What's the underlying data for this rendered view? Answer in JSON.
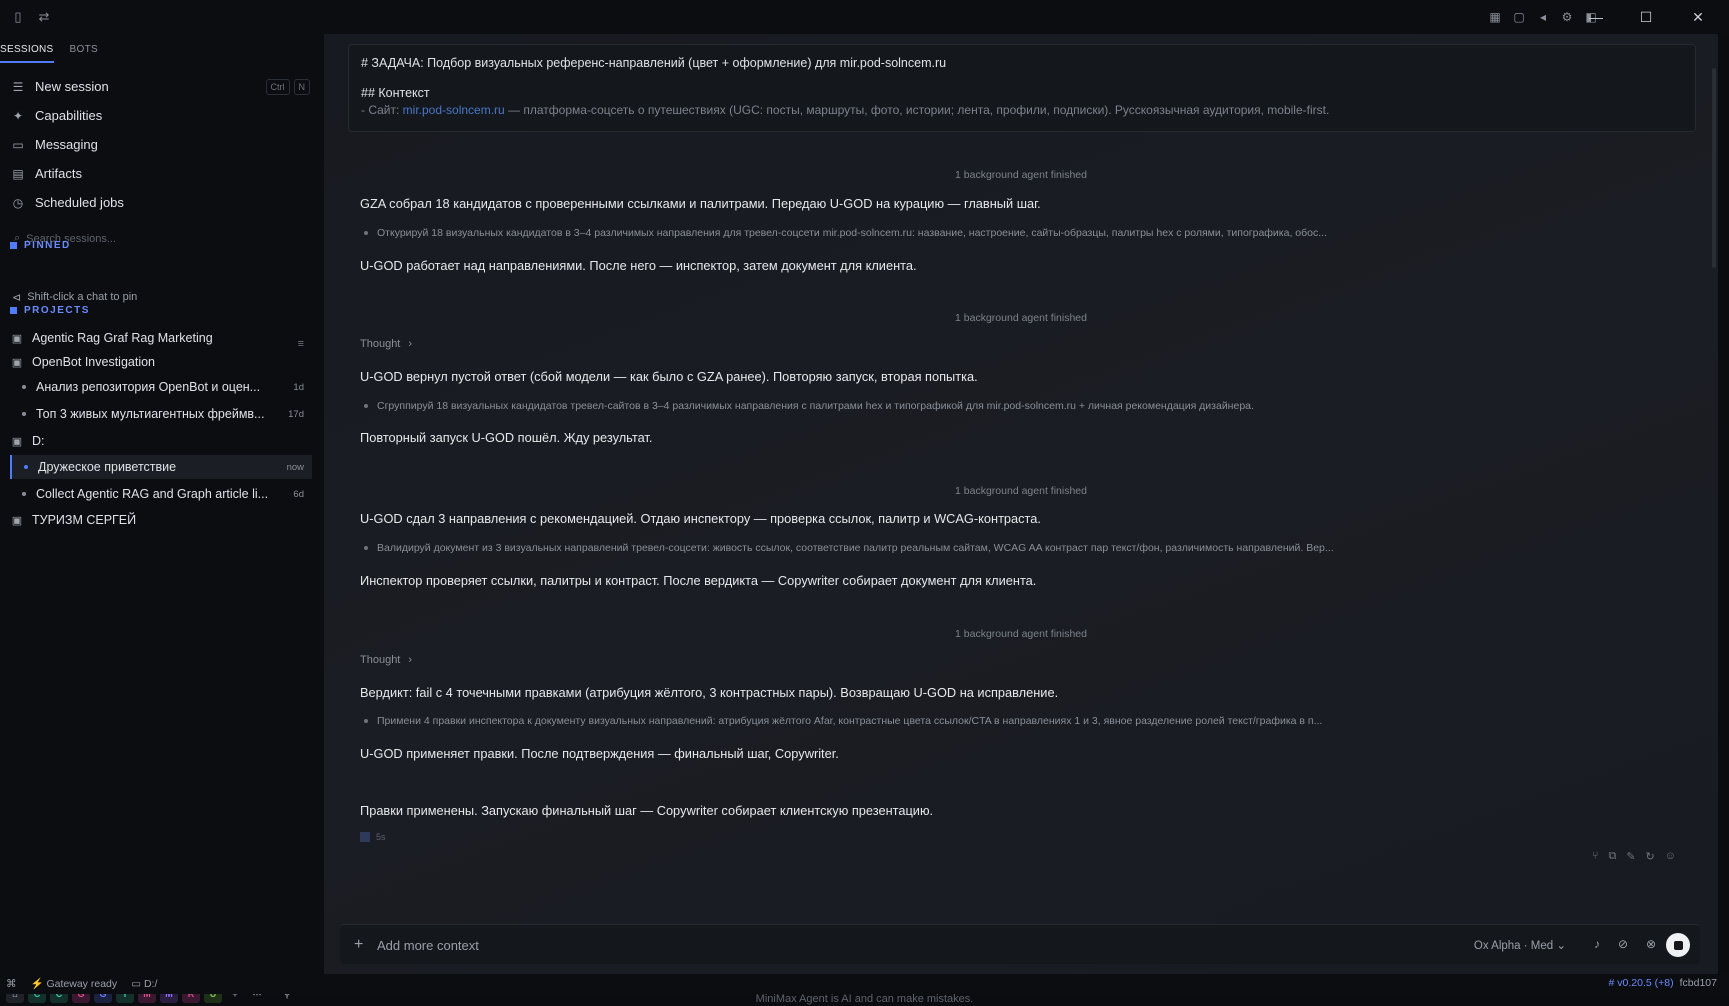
{
  "sidebar": {
    "tabs": [
      "SESSIONS",
      "BOTS"
    ],
    "nav": [
      {
        "label": "New session",
        "icon": "new-session-icon"
      },
      {
        "label": "Capabilities",
        "icon": "capabilities-icon"
      },
      {
        "label": "Messaging",
        "icon": "message-icon"
      },
      {
        "label": "Artifacts",
        "icon": "artifacts-icon"
      },
      {
        "label": "Scheduled jobs",
        "icon": "clock-icon"
      }
    ],
    "shortcut": [
      "Ctrl",
      "N"
    ],
    "search_placeholder": "Search sessions...",
    "pinned_heading": "PINNED",
    "pin_hint": "Shift-click a chat to pin",
    "projects_heading": "PROJECTS",
    "projects": [
      {
        "name": "Agentic Rag Graf Rag Marketing"
      },
      {
        "name": "OpenBot Investigation"
      },
      {
        "name": "D:"
      },
      {
        "name": "ТУРИЗМ СЕРГЕЙ"
      }
    ],
    "chats": [
      {
        "title": "Анализ репозитория OpenBot и оцен...",
        "age": "1d"
      },
      {
        "title": "Топ 3 живых мультиагентных фреймв...",
        "age": "17d"
      },
      {
        "title": "Дружеское приветствие",
        "age": "now"
      },
      {
        "title": "Collect Agentic RAG and Graph article li...",
        "age": "6d"
      }
    ],
    "workspaces": [
      "C",
      "C",
      "G",
      "G",
      "I",
      "M",
      "M",
      "R",
      "U"
    ]
  },
  "main": {
    "prompt_line1": "# ЗАДАЧА: Подбор визуальных референс-направлений (цвет + оформление) для mir.pod-solncem.ru",
    "prompt_line2": "## Контекст",
    "prompt_line3_prefix": "- Сайт: ",
    "prompt_line3_link": "mir.pod-solncem.ru",
    "prompt_line3_rest": " — платформа-соцсеть о путешествиях (UGC: посты, маршруты, фото, истории; лента, профили, подписки). Русскоязычная аудитория, mobile-first.",
    "agent_finished": "1 background agent finished",
    "thought_label": "Thought",
    "messages": [
      "GZA собрал 18 кандидатов с проверенными ссылками и палитрами. Передаю U-GOD на курацию — главный шаг.",
      "U-GOD работает над направлениями. После него — инспектор, затем документ для клиента.",
      "U-GOD вернул пустой ответ (сбой модели — как было с GZA ранее). Повторяю запуск, вторая попытка.",
      "Повторный запуск U-GOD пошёл. Жду результат.",
      "U-GOD сдал 3 направления с рекомендацией. Отдаю инспектору — проверка ссылок, палитр и WCAG-контраста.",
      "Инспектор проверяет ссылки, палитры и контраст. После вердикта — Copywriter собирает документ для клиента.",
      "Вердикт: fail с 4 точечными правками (атрибуция жёлтого, 3 контрастных пары). Возвращаю U-GOD на исправление.",
      "U-GOD применяет правки. После подтверждения — финальный шаг, Copywriter.",
      "Правки применены. Запускаю финальный шаг — Copywriter собирает клиентскую презентацию."
    ],
    "subtasks": [
      "Откурируй 18 визуальных кандидатов в 3–4 различимых направления для тревел-соцсети mir.pod-solncem.ru: название, настроение, сайты-образцы, палитры hex с ролями, типографика, обос...",
      "Сгруппируй 18 визуальных кандидатов тревел-сайтов в 3–4 различимых направления с палитрами hex и типографикой для mir.pod-solncem.ru + личная рекомендация дизайнера.",
      "Валидируй документ из 3 визуальных направлений тревел-соцсети: живость ссылок, соответствие палитр реальным сайтам, WCAG AA контраст пар текст/фон, различимость направлений. Вер...",
      "Примени 4 правки инспектора к документу визуальных направлений: атрибуция жёлтого Afar, контрастные цвета ссылок/CTA в направлениях 1 и 3, явное разделение ролей текст/графика в п..."
    ],
    "elapsed": "5s"
  },
  "composer": {
    "placeholder": "Add more context",
    "model": "Ox Alpha · Med"
  },
  "statusbar": {
    "gateway": "Gateway ready",
    "path": "D:/",
    "version": "v0.20.5 (+8)",
    "commit": "fcbd107"
  },
  "disclaimer": "MiniMax Agent is AI and can make mistakes.",
  "colors": {
    "accent": "#4f7cff",
    "background": "#0a0c10",
    "panel": "#171a20"
  }
}
